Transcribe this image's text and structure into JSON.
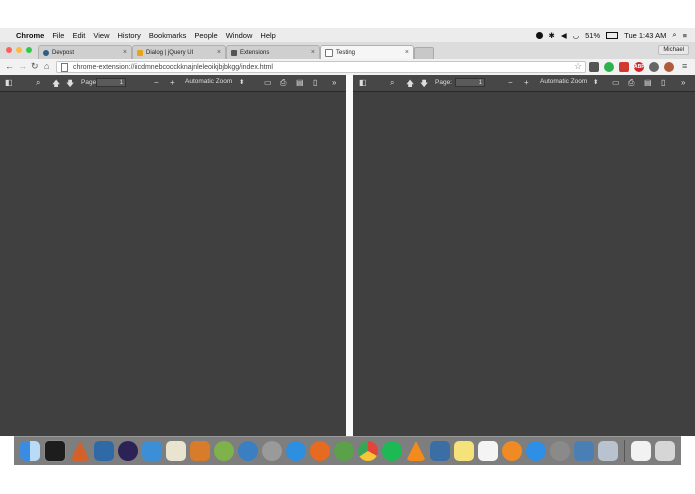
{
  "menubar": {
    "app_name": "Chrome",
    "items": [
      "File",
      "Edit",
      "View",
      "History",
      "Bookmarks",
      "People",
      "Window",
      "Help"
    ],
    "battery": "51%",
    "clock": "Tue 1:43 AM"
  },
  "tabs": [
    {
      "label": "Devpost",
      "favicon_color": "#2c5f8a"
    },
    {
      "label": "Dialog | jQuery UI",
      "favicon_color": "#e8a319"
    },
    {
      "label": "Extensions",
      "favicon_color": "#555555"
    },
    {
      "label": "Testing",
      "favicon_color": "#ffffff"
    }
  ],
  "profile_name": "Michael",
  "address": "chrome-extension://iicdmnebcocckknajnleleoikjbjbkgg/index.html",
  "extensions": [
    {
      "name": "pocket-icon",
      "color": "#555555",
      "text": ""
    },
    {
      "name": "evernote-icon",
      "color": "#2eb24b",
      "text": ""
    },
    {
      "name": "lastpass-icon",
      "color": "#d03a2f",
      "text": ""
    },
    {
      "name": "adblock-icon",
      "color": "#d4232a",
      "text": "ABP"
    },
    {
      "name": "zoom-icon",
      "color": "#666666",
      "text": ""
    },
    {
      "name": "avatar-icon",
      "color": "#b05a3a",
      "text": ""
    }
  ],
  "viewer": {
    "page_label": "Page:",
    "page_value": "1",
    "zoom_label": "Automatic Zoom",
    "zoom_arrow": "⬍"
  },
  "colors": {
    "pdf_bg": "#404040",
    "pdf_toolbar": "#474747"
  },
  "dock_apps": [
    "finder",
    "terminal",
    "matlab",
    "virtualbox",
    "eclipse",
    "xcode",
    "preview",
    "sublime",
    "android-studio",
    "sync",
    "rocket",
    "safari",
    "firefox",
    "network",
    "chrome",
    "spotify",
    "vlc",
    "preview2",
    "notes",
    "textedit",
    "ibooks",
    "app-store",
    "system-preferences",
    "onyx",
    "screenshot",
    "documents",
    "trash"
  ]
}
